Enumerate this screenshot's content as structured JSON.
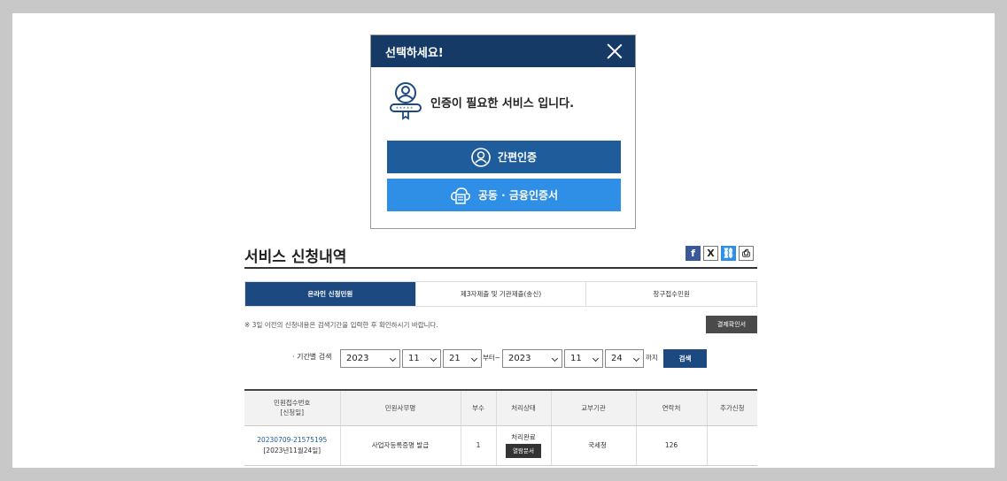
{
  "modal": {
    "title": "선택하세요!",
    "message": "인증이 필요한 서비스 입니다.",
    "simple_auth_label": "간편인증",
    "cert_auth_label": "공동 · 금융인증서"
  },
  "section": {
    "title": "서비스 신청내역",
    "share_icons": [
      "facebook-icon",
      "x-icon",
      "link-icon",
      "print-icon"
    ]
  },
  "tabs": [
    {
      "label": "온라인 신청민원",
      "active": true
    },
    {
      "label": "제3자제출 및 기관제출(송신)",
      "active": false
    },
    {
      "label": "창구접수민원",
      "active": false
    }
  ],
  "notice": "※ 3일 이전의 신청내용은 검색기간을 입력한 후 확인하시기 바랍니다.",
  "payment_confirm_label": "결제확인서",
  "filter": {
    "label": "· 기간별 검색",
    "from": {
      "year": "2023",
      "month": "11",
      "day": "21"
    },
    "from_suffix": "부터~",
    "to": {
      "year": "2023",
      "month": "11",
      "day": "24"
    },
    "to_suffix": "까지",
    "search_label": "검색"
  },
  "table": {
    "headers": {
      "receipt_no": "민원접수번호",
      "receipt_date_hdr": "[신청일]",
      "task_name": "민원사무명",
      "copies": "부수",
      "status": "처리상태",
      "agency": "교부기관",
      "contact": "연락처",
      "extra": "추가신청"
    },
    "rows": [
      {
        "receipt_no": "20230709-21575195",
        "date": "[2023년11월24일]",
        "task_name": "사업자등록증명 발급",
        "copies": "1",
        "status": "처리완료",
        "doc_label": "열람문서",
        "agency": "국세청",
        "contact": "126",
        "extra": ""
      }
    ]
  },
  "colors": {
    "navy": "#153a66",
    "tab_active": "#1c4a80",
    "btn_simple": "#1e5c9c",
    "btn_cert": "#2f8ee6",
    "backdrop": "#c8c8c8"
  }
}
